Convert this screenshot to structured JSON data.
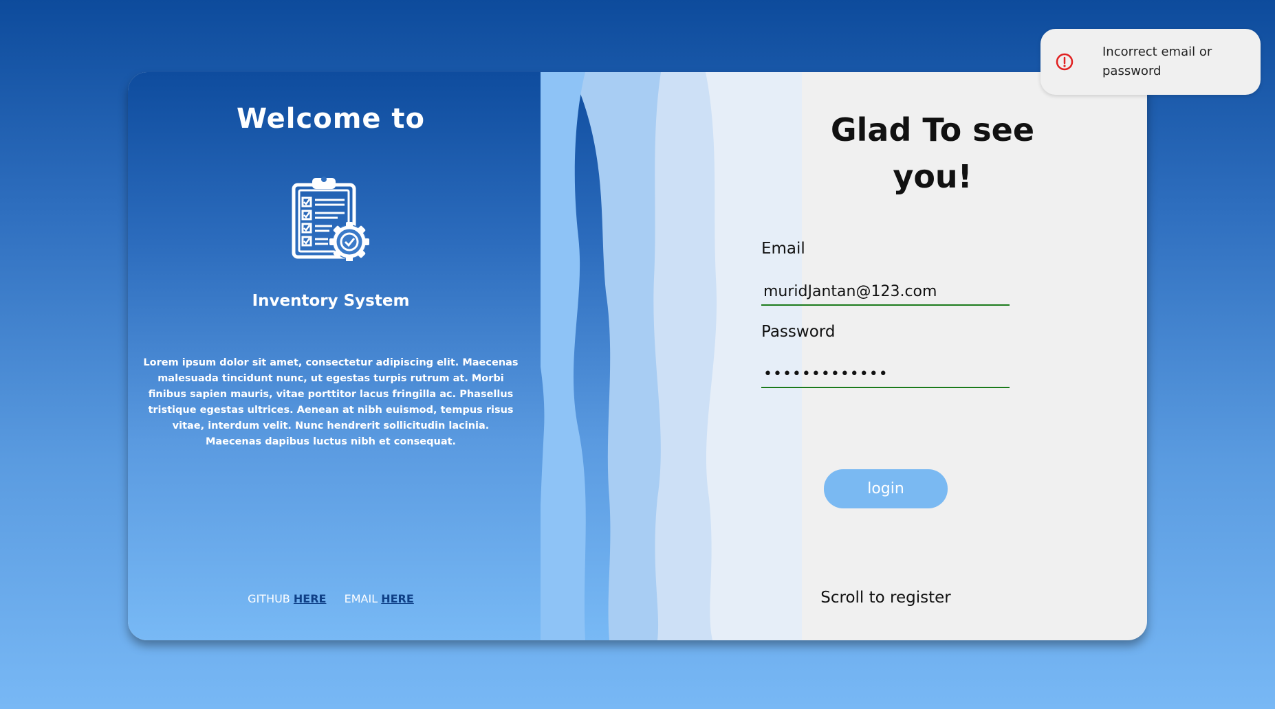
{
  "left_panel": {
    "welcome_title": "Welcome to",
    "logo_icon": "clipboard-checklist-gear-icon",
    "system_name": "Inventory System",
    "description": "Lorem ipsum dolor sit amet, consectetur adipiscing elit. Maecenas malesuada tincidunt nunc, ut egestas turpis rutrum at. Morbi finibus sapien mauris, vitae porttitor lacus fringilla ac. Phasellus tristique egestas ultrices. Aenean at nibh euismod, tempus risus vitae, interdum velit. Nunc hendrerit sollicitudin lacinia. Maecenas dapibus luctus nibh et consequat.",
    "footer": {
      "github_label": "GITHUB",
      "github_link": "HERE",
      "email_label": "EMAIL",
      "email_link": "HERE"
    }
  },
  "login_form": {
    "title": "Glad To see you!",
    "email_label": "Email",
    "email_value": "muridJantan@123.com",
    "password_label": "Password",
    "password_value": "•••••••••••••",
    "login_button": "login",
    "scroll_hint": "Scroll to register"
  },
  "toast": {
    "icon": "error-circle-icon",
    "message": "Incorrect email or password"
  },
  "colors": {
    "accent": "#7ab9f2",
    "input_underline": "#1a7a1a",
    "error": "#e02020",
    "link": "#0e3f86"
  }
}
